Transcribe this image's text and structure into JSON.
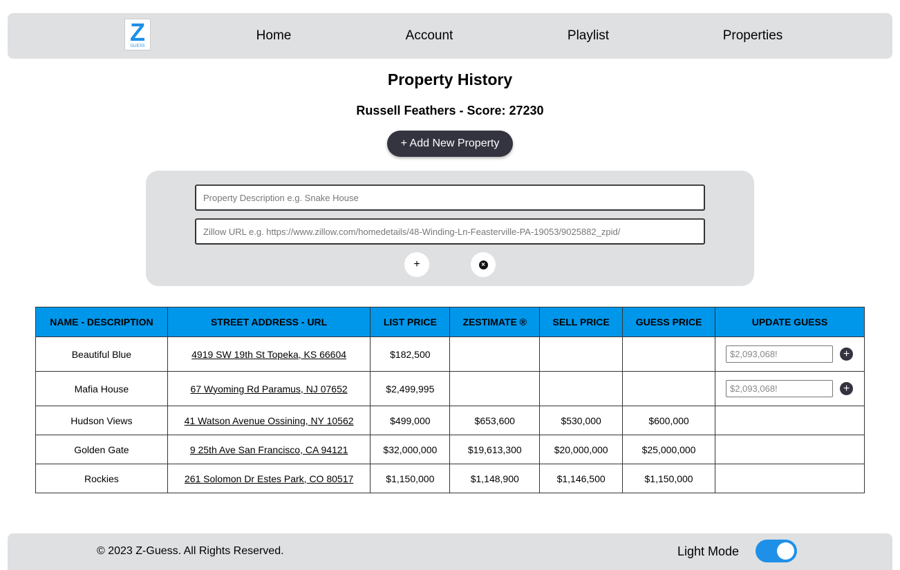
{
  "nav": {
    "logo_letter": "Z",
    "logo_sub": "GUESS",
    "items": [
      "Home",
      "Account",
      "Playlist",
      "Properties"
    ]
  },
  "page": {
    "title": "Property History",
    "subtitle": "Russell Feathers - Score: 27230",
    "add_button": "+ Add New Property"
  },
  "form": {
    "description_placeholder": "Property Description e.g. Snake House",
    "url_placeholder": "Zillow URL e.g. https://www.zillow.com/homedetails/48-Winding-Ln-Feasterville-PA-19053/9025882_zpid/",
    "submit_icon": "plus-icon",
    "cancel_icon": "close-circle-icon"
  },
  "table": {
    "headers": [
      "NAME - DESCRIPTION",
      "STREET ADDRESS - URL",
      "LIST PRICE",
      "ZESTIMATE ®",
      "SELL PRICE",
      "GUESS PRICE",
      "UPDATE GUESS"
    ],
    "rows": [
      {
        "name": "Beautiful Blue",
        "address": "4919 SW 19th St Topeka, KS 66604",
        "list": "$182,500",
        "zestimate": "",
        "sell": "",
        "guess": "",
        "update_placeholder": "$2,093,068!"
      },
      {
        "name": "Mafia House",
        "address": "67 Wyoming Rd Paramus, NJ 07652",
        "list": "$2,499,995",
        "zestimate": "",
        "sell": "",
        "guess": "",
        "update_placeholder": "$2,093,068!"
      },
      {
        "name": "Hudson Views",
        "address": "41 Watson Avenue Ossining, NY 10562",
        "list": "$499,000",
        "zestimate": "$653,600",
        "sell": "$530,000",
        "guess": "$600,000"
      },
      {
        "name": "Golden Gate",
        "address": "9 25th Ave San Francisco, CA 94121",
        "list": "$32,000,000",
        "zestimate": "$19,613,300",
        "sell": "$20,000,000",
        "guess": "$25,000,000"
      },
      {
        "name": "Rockies",
        "address": "261 Solomon Dr Estes Park, CO 80517",
        "list": "$1,150,000",
        "zestimate": "$1,148,900",
        "sell": "$1,146,500",
        "guess": "$1,150,000"
      }
    ]
  },
  "footer": {
    "copyright": "© 2023 Z-Guess. All Rights Reserved.",
    "mode_label": "Light Mode",
    "mode_on": true
  },
  "colors": {
    "header": "#0096ea",
    "accent": "#1e90e8",
    "button": "#33343f"
  }
}
